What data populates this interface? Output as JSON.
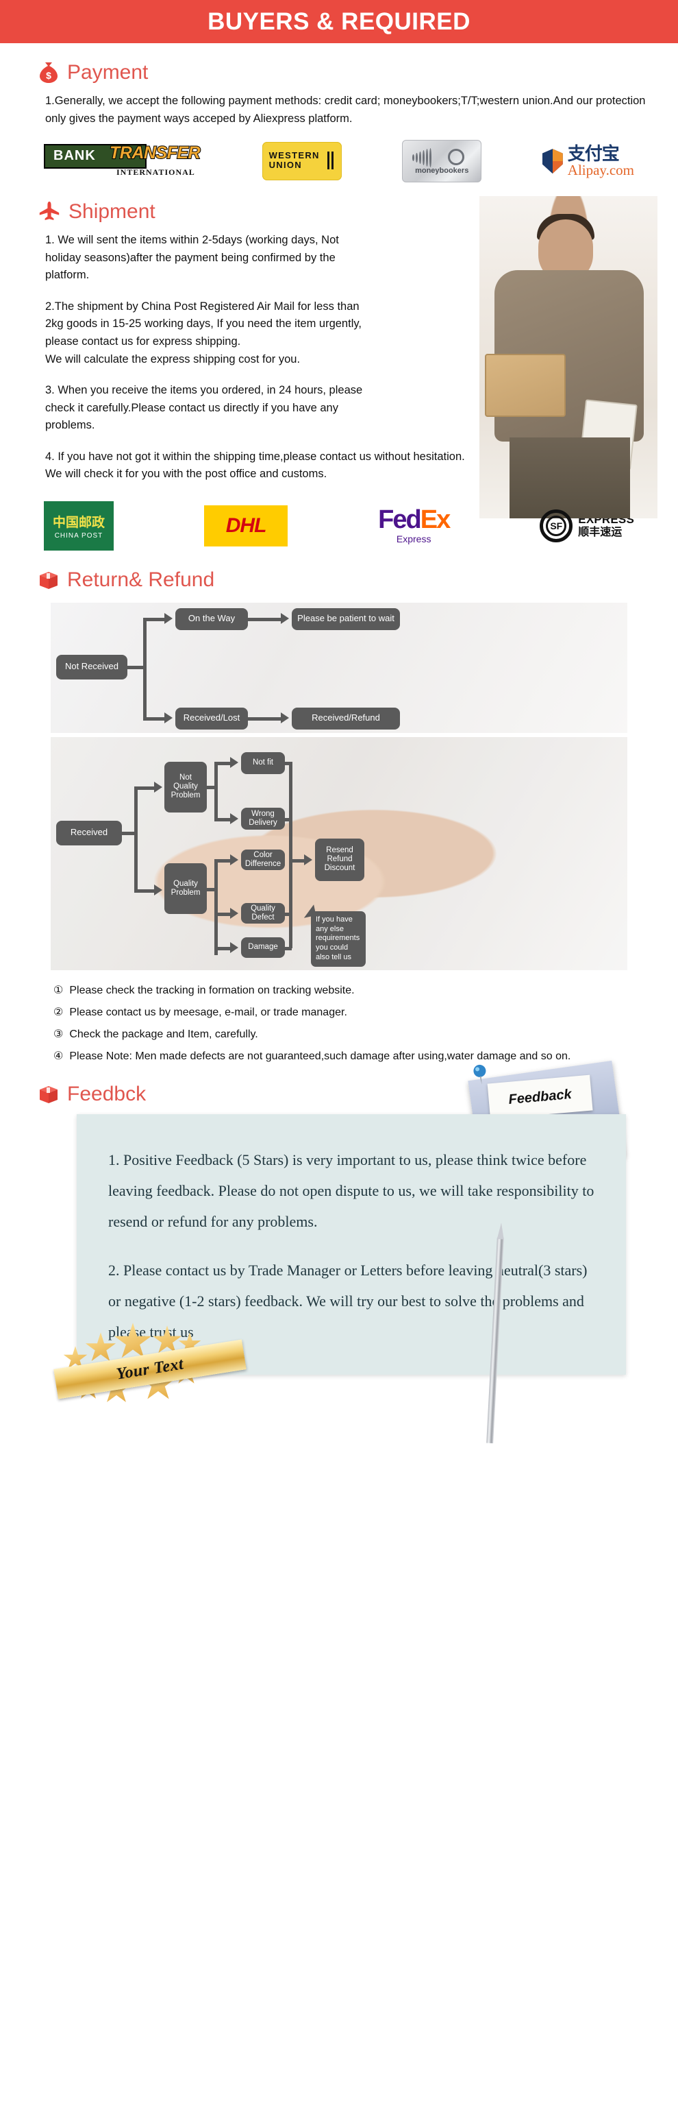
{
  "header": {
    "title": "BUYERS & REQUIRED"
  },
  "payment": {
    "icon": "money-bag-icon",
    "title": "Payment",
    "paragraph": "1.Generally, we accept the following payment methods: credit card; moneybookers;T/T;western union.And our protection only gives the payment ways acceped by Aliexpress platform.",
    "logos": [
      {
        "name": "bank-transfer-logo",
        "word": "BANK",
        "accent": "TRANSFER",
        "sub": "INTERNATIONAL"
      },
      {
        "name": "western-union-logo",
        "line1": "WESTERN",
        "line2": "UNION"
      },
      {
        "name": "moneybookers-logo",
        "label": "moneybookers"
      },
      {
        "name": "alipay-logo",
        "cn": "支付宝",
        "com": "Alipay.com"
      }
    ]
  },
  "shipment": {
    "icon": "airplane-icon",
    "title": "Shipment",
    "paragraphs": [
      "1. We will sent the items within 2-5days (working days, Not holiday seasons)after the payment being confirmed by the platform.",
      "2.The shipment by China Post Registered Air Mail for less than  2kg goods in 15-25 working days, If  you need the item urgently, please contact us for express shipping.\nWe will calculate the express shipping cost for you.",
      "3. When you receive the items you ordered, in 24 hours, please check it carefully.Please contact us directly if you have any problems.",
      "4. If you have not got it within the shipping time,please contact us without hesitation. We will check it for you with the post office and customs."
    ],
    "logos": [
      {
        "name": "china-post-logo",
        "cn": "中国邮政",
        "en": "CHINA POST"
      },
      {
        "name": "dhl-logo",
        "word": "DHL"
      },
      {
        "name": "fedex-logo",
        "part1": "Fed",
        "part2": "Ex",
        "sub": "Express"
      },
      {
        "name": "sf-express-logo",
        "mark": "SF",
        "en": "EXPRESS",
        "cn": "顺丰速运"
      }
    ]
  },
  "return_refund": {
    "icon": "package-icon",
    "title": "Return& Refund",
    "flow1": {
      "start": "Not Received",
      "branch_top": "On the Way",
      "branch_bottom": "Received/Lost",
      "end_top": "Please be patient to wait",
      "end_bottom": "Received/Refund"
    },
    "flow2": {
      "start": "Received",
      "group_top": "Not\nQuality\nProblem",
      "group_bottom": "Quality\nProblem",
      "leaves": [
        "Not fit",
        "Wrong Delivery",
        "Color Difference",
        "Quality Defect",
        "Damage"
      ],
      "result": "Resend\nRefund\nDiscount",
      "callout": "If you have any else requirements you could also tell us"
    },
    "notes": [
      {
        "marker": "①",
        "text": "Please check the tracking in formation on tracking website."
      },
      {
        "marker": "②",
        "text": "Please contact us by meesage, e-mail, or trade manager."
      },
      {
        "marker": "③",
        "text": "Check the package and Item, carefully."
      },
      {
        "marker": "④",
        "text": "Please Note: Men made defects  are not guaranteed,such damage after using,water damage and so on."
      }
    ]
  },
  "feedback": {
    "icon": "package-icon",
    "title": "Feedbck",
    "photo_sign": "Feedback",
    "paragraphs": [
      "1. Positive Feedback (5 Stars) is very important to us, please think twice before leaving feedback. Please do not open dispute to us,   we will take responsibility to resend or refund for any problems.",
      "2. Please contact us by Trade Manager or Letters before leaving neutral(3 stars) or negative (1-2 stars) feedback. We will try our best to solve the problems and please trust us"
    ],
    "badge_text": "Your Text"
  },
  "colors": {
    "brand_red": "#ea4a40",
    "heading_red": "#e0564e",
    "node_gray": "#5a5a5a",
    "feedback_card": "#dfeaea"
  }
}
